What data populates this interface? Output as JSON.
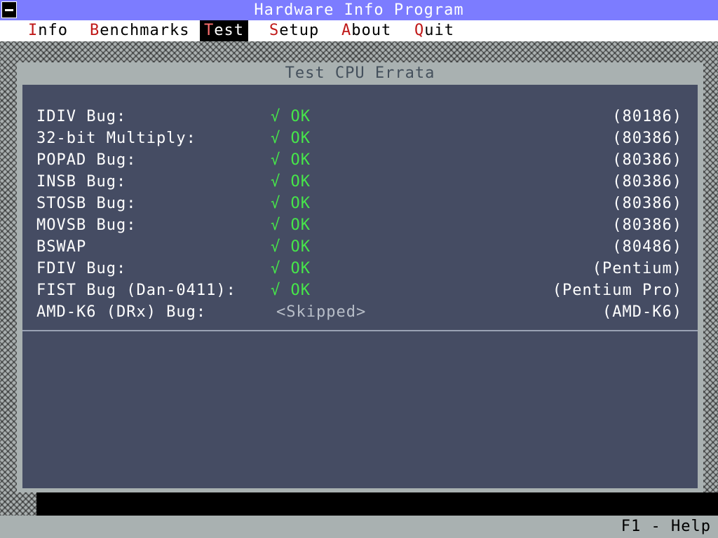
{
  "titlebar": {
    "title": "Hardware Info Program"
  },
  "menu": [
    {
      "hotkey": "I",
      "rest": "nfo",
      "active": false
    },
    {
      "hotkey": "B",
      "rest": "enchmarks",
      "active": false
    },
    {
      "hotkey": "T",
      "rest": "est",
      "active": true
    },
    {
      "hotkey": "S",
      "rest": "etup",
      "active": false
    },
    {
      "hotkey": "A",
      "rest": "bout",
      "active": false
    },
    {
      "hotkey": "Q",
      "rest": "uit",
      "active": false
    }
  ],
  "window": {
    "title": "Test CPU Errata"
  },
  "tests": [
    {
      "label": "IDIV Bug:",
      "mark": "√",
      "result": "OK",
      "cpu": "(80186)"
    },
    {
      "label": "32-bit Multiply:",
      "mark": "√",
      "result": "OK",
      "cpu": "(80386)"
    },
    {
      "label": "POPAD Bug:",
      "mark": "√",
      "result": "OK",
      "cpu": "(80386)"
    },
    {
      "label": "INSB Bug:",
      "mark": "√",
      "result": "OK",
      "cpu": "(80386)"
    },
    {
      "label": "STOSB Bug:",
      "mark": "√",
      "result": "OK",
      "cpu": "(80386)"
    },
    {
      "label": "MOVSB Bug:",
      "mark": "√",
      "result": "OK",
      "cpu": "(80386)"
    },
    {
      "label": "BSWAP",
      "mark": "√",
      "result": "OK",
      "cpu": "(80486)"
    },
    {
      "label": "FDIV Bug:",
      "mark": "√",
      "result": "OK",
      "cpu": "(Pentium)"
    },
    {
      "label": "FIST Bug (Dan-0411):",
      "mark": "√",
      "result": "OK",
      "cpu": "(Pentium Pro)"
    },
    {
      "label": "AMD-K6 (DRx) Bug:",
      "mark": "",
      "result": "<Skipped>",
      "cpu": "(AMD-K6)"
    }
  ],
  "statusbar": {
    "help": "F1 - Help"
  },
  "colors": {
    "titlebar": "#7c7cff",
    "panel": "#454c63",
    "ok": "#46e64a",
    "hotkey": "#c01818"
  }
}
